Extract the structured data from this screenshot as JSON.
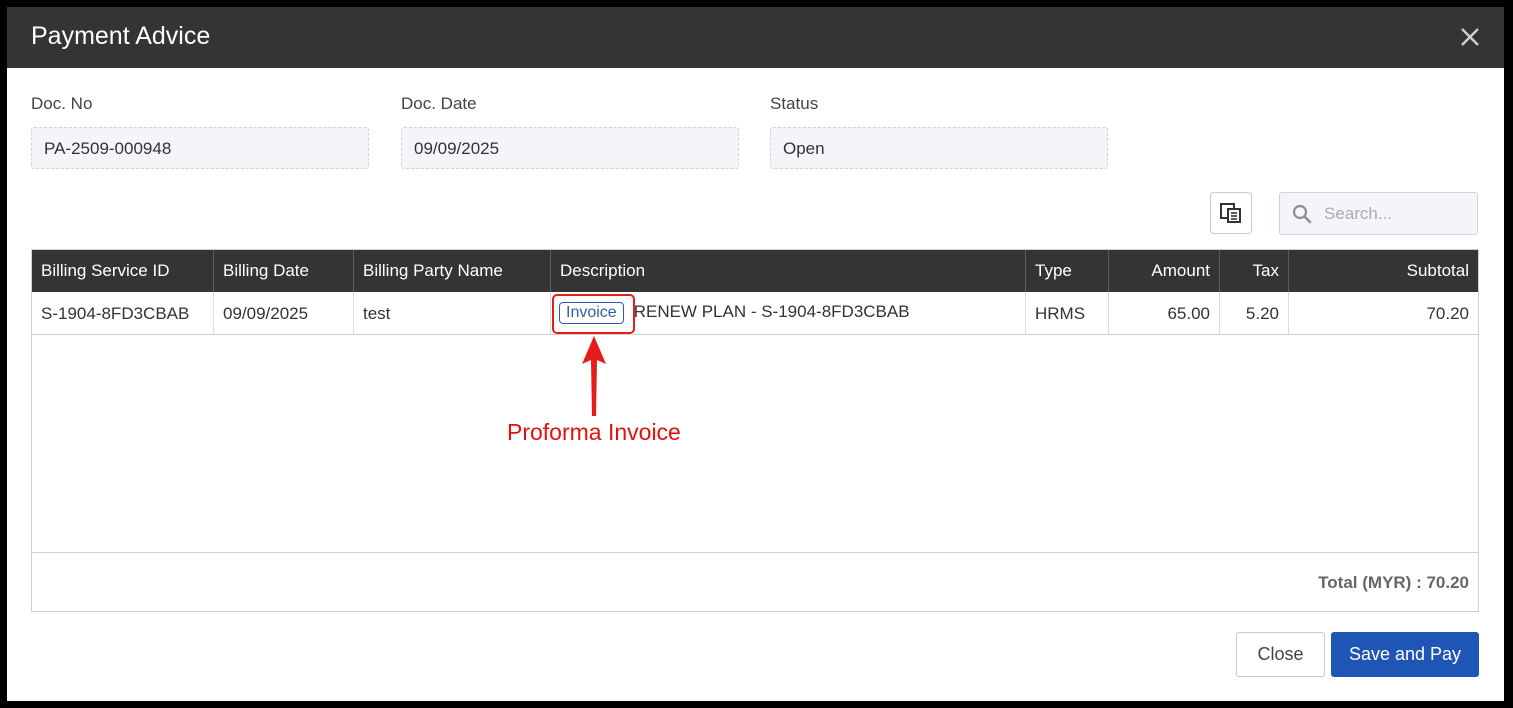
{
  "modal": {
    "title": "Payment Advice",
    "close_icon": "close-icon"
  },
  "fields": {
    "doc_no": {
      "label": "Doc. No",
      "value": "PA-2509-000948"
    },
    "doc_date": {
      "label": "Doc. Date",
      "value": "09/09/2025"
    },
    "status": {
      "label": "Status",
      "value": "Open"
    }
  },
  "toolbar": {
    "column_chooser_icon": "column-chooser-icon",
    "search": {
      "placeholder": "Search...",
      "icon": "search-icon"
    }
  },
  "grid": {
    "columns": [
      "Billing Service ID",
      "Billing Date",
      "Billing Party Name",
      "Description",
      "Type",
      "Amount",
      "Tax",
      "Subtotal"
    ],
    "rows": [
      {
        "billing_service_id": "S-1904-8FD3CBAB",
        "billing_date": "09/09/2025",
        "billing_party_name": "test",
        "description_chip": "Invoice",
        "description": "RENEW PLAN - S-1904-8FD3CBAB",
        "type": "HRMS",
        "amount": "65.00",
        "tax": "5.20",
        "subtotal": "70.20"
      }
    ],
    "total": "Total (MYR) : 70.20"
  },
  "annotation": {
    "text": "Proforma Invoice",
    "color": "#e40f0f"
  },
  "buttons": {
    "close": "Close",
    "save_and_pay": "Save and Pay"
  },
  "colors": {
    "header_bg": "#343434",
    "primary": "#1f56b6",
    "chip": "#2f5ea8"
  }
}
